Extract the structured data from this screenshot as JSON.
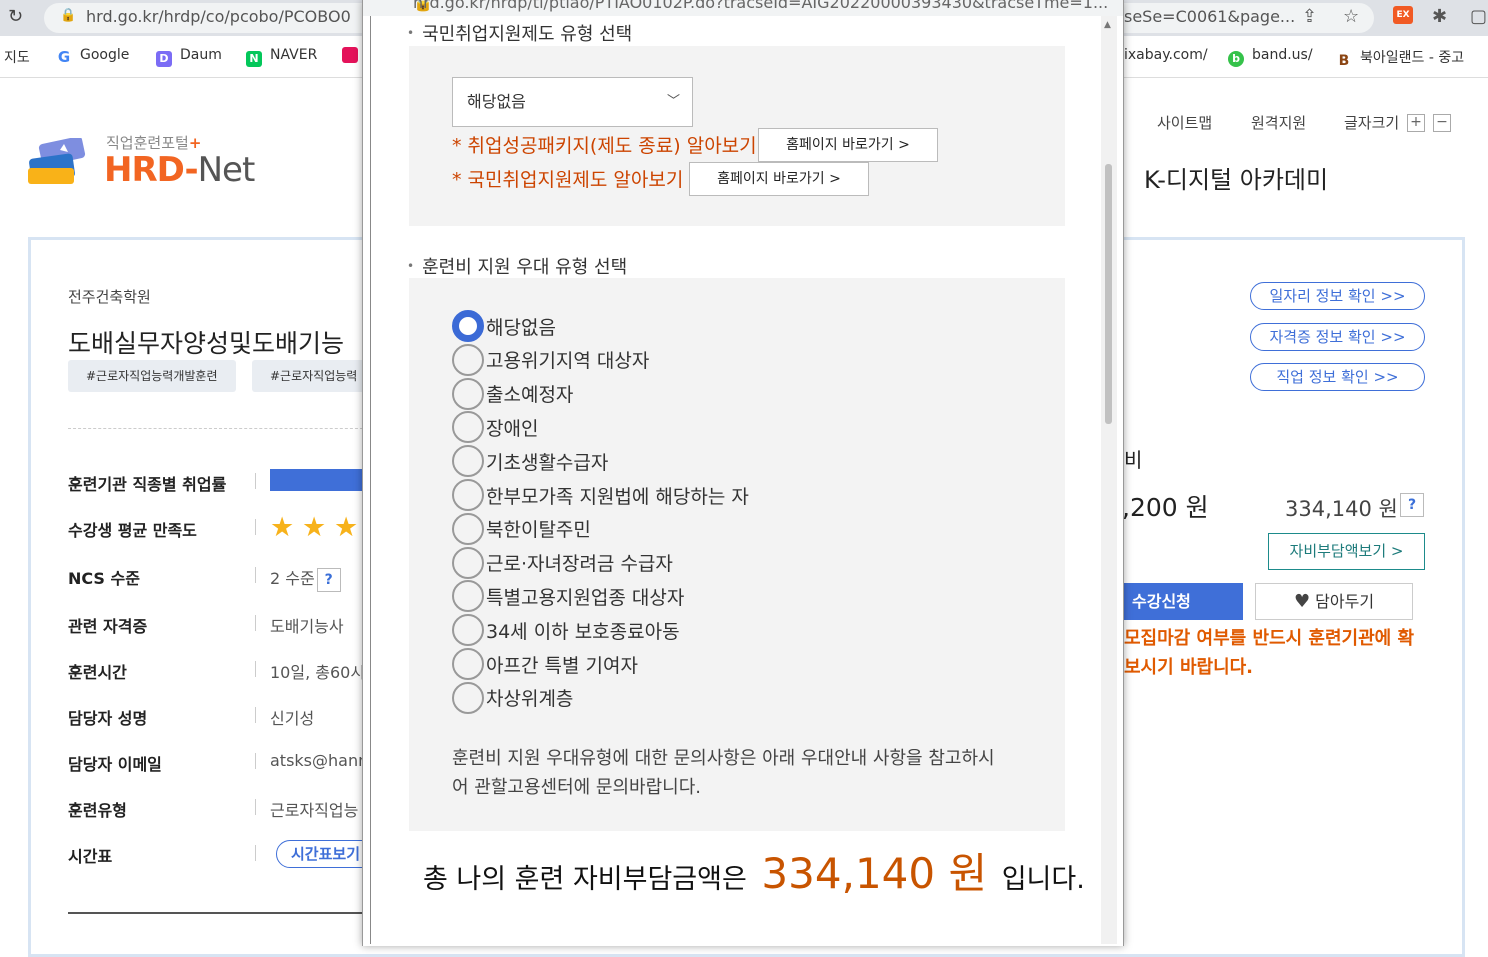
{
  "browser": {
    "url_left": "hrd.go.kr/hrdp/co/pcobo/PCOBO0",
    "url_right": "seSe=C0061&page...",
    "ext_label": "EX"
  },
  "bookmarks": [
    {
      "label": "지도",
      "icon": "map-icon"
    },
    {
      "label": "Google",
      "icon": "google-icon"
    },
    {
      "label": "Daum",
      "icon": "daum-icon"
    },
    {
      "label": "NAVER",
      "icon": "naver-icon"
    },
    {
      "label": "ixabay.com/",
      "icon": ""
    },
    {
      "label": "band.us/",
      "icon": "band-icon"
    },
    {
      "label": "북아일랜드 - 중고",
      "icon": "bookmark-b-icon"
    }
  ],
  "site": {
    "logo_sub": "직업훈련포털",
    "logo_plus": "+",
    "logo_hrd": "HRD",
    "logo_dash": "-",
    "logo_net": "Net",
    "top_links": [
      "사이트맵",
      "원격지원",
      "글자크기"
    ],
    "fs_plus": "+",
    "fs_minus": "−",
    "academy": "K-디지털 아카데미"
  },
  "course": {
    "institution": "전주건축학원",
    "title": "도배실무자양성및도배기능",
    "tags": [
      "#근로자직업능력개발훈련",
      "#근로자직업능력"
    ],
    "rows": [
      {
        "label": "훈련기관 직종별 취업률",
        "value": ""
      },
      {
        "label": "수강생 평균 만족도",
        "value": ""
      },
      {
        "label": "NCS 수준",
        "value": "2 수준"
      },
      {
        "label": "관련 자격증",
        "value": "도배기능사"
      },
      {
        "label": "훈련시간",
        "value": "10일, 총60시"
      },
      {
        "label": "담당자 성명",
        "value": "신기성"
      },
      {
        "label": "담당자 이메일",
        "value": "atsks@hann"
      },
      {
        "label": "훈련유형",
        "value": "근로자직업능"
      },
      {
        "label": "시간표",
        "value": ""
      }
    ],
    "stars": [
      "★",
      "★",
      "★"
    ],
    "qmark": "?",
    "timetable_btn": "시간표보기"
  },
  "right_panel": {
    "pills": [
      "일자리 정보 확인 >>",
      "자격증 정보 확인 >>",
      "직업 정보 확인 >>"
    ],
    "fee_label_fragment": "비",
    "price_left": ",200 원",
    "price_right": "334,140 원",
    "qmark": "?",
    "self_pay_btn": "자비부담액보기 >",
    "apply_btn": "수강신청",
    "fav_btn": "담아두기",
    "warning_1": "모집마감 여부를 반드시 훈련기관에 확",
    "warning_2": "보시기 바랍니다."
  },
  "popup": {
    "url": "hrd.go.kr/hrdp/ti/ptiao/PTIAO0102P.do?tracseId=AIG20220000393430&tracseTme=1...",
    "section1_title": "국민취업지원제도 유형 선택",
    "select_value": "해당없음",
    "link1_text": "* 취업성공패키지(제도 종료) 알아보기",
    "link1_btn": "홈페이지 바로가기 >",
    "link2_text": "* 국민취업지원제도 알아보기",
    "link2_btn": "홈페이지 바로가기 >",
    "section2_title": "훈련비 지원 우대 유형 선택",
    "options": [
      "해당없음",
      "고용위기지역 대상자",
      "출소예정자",
      "장애인",
      "기초생활수급자",
      "한부모가족 지원법에 해당하는 자",
      "북한이탈주민",
      "근로·자녀장려금 수급자",
      "특별고용지원업종 대상자",
      "34세 이하 보호종료아동",
      "아프간 특별 기여자",
      "차상위계층"
    ],
    "selected_index": 0,
    "note_1": "훈련비 지원 우대유형에 대한 문의사항은 아래 우대안내 사항을 참고하시",
    "note_2": "어 관할고용센터에 문의바랍니다.",
    "total_prefix": "총 나의 훈련 자비부담금액은",
    "total_amount": "334,140 원",
    "total_suffix": "입니다."
  },
  "colors": {
    "accent_blue": "#3f6fd8",
    "orange": "#cc4400",
    "brand_orange": "#f26522"
  }
}
